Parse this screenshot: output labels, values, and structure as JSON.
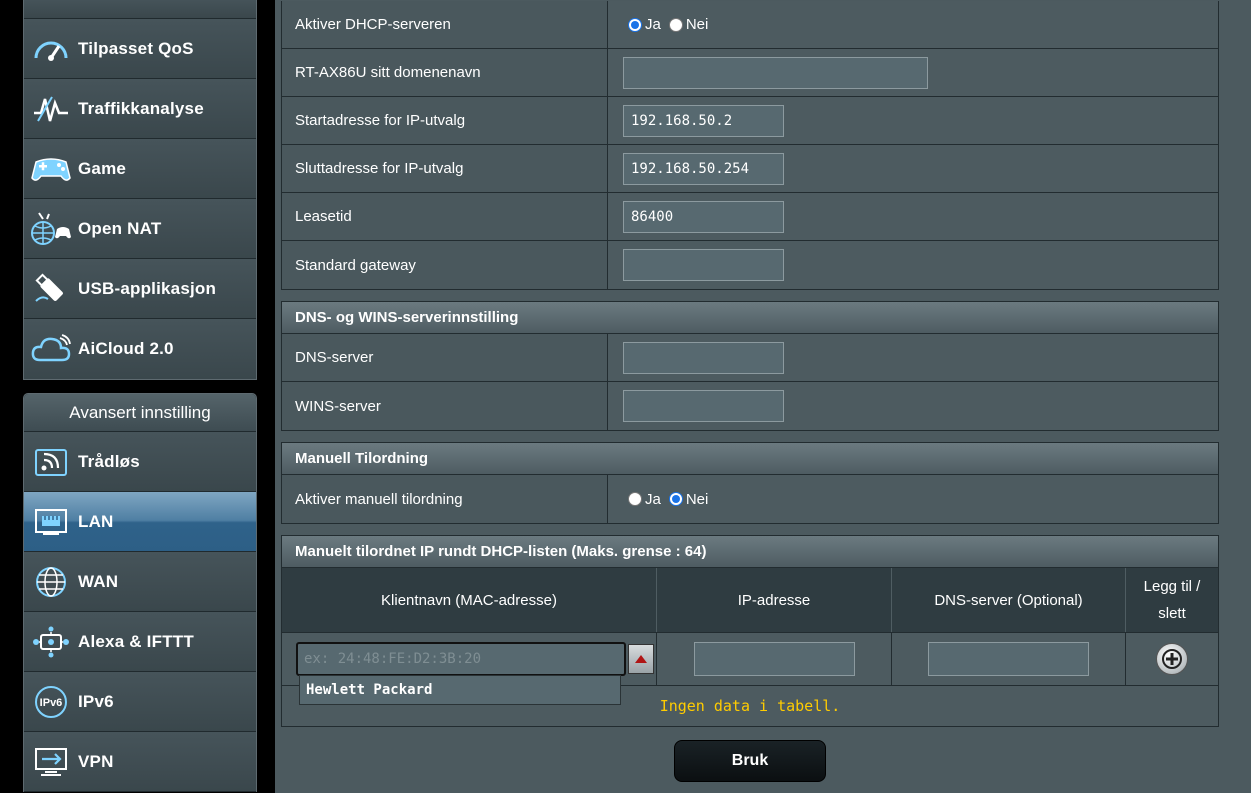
{
  "sidebar": {
    "general_items": [
      {
        "label": "Tilpasset QoS",
        "icon": "speedometer-icon"
      },
      {
        "label": "Traffikkanalyse",
        "icon": "traffic-analyzer-icon"
      },
      {
        "label": "Game",
        "icon": "gamepad-icon"
      },
      {
        "label": "Open NAT",
        "icon": "open-nat-icon"
      },
      {
        "label": "USB-applikasjon",
        "icon": "usb-icon"
      },
      {
        "label": "AiCloud 2.0",
        "icon": "cloud-icon"
      }
    ],
    "advanced_header": "Avansert innstilling",
    "advanced_items": [
      {
        "label": "Trådløs",
        "icon": "wireless-icon"
      },
      {
        "label": "LAN",
        "icon": "lan-icon",
        "active": true
      },
      {
        "label": "WAN",
        "icon": "globe-icon"
      },
      {
        "label": "Alexa & IFTTT",
        "icon": "alexa-icon"
      },
      {
        "label": "IPv6",
        "icon": "ipv6-icon"
      },
      {
        "label": "VPN",
        "icon": "vpn-icon"
      }
    ]
  },
  "dhcp": {
    "enable_label": "Aktiver DHCP-serveren",
    "enable_yes": "Ja",
    "enable_no": "Nei",
    "enable_value": "Ja",
    "domain_label": "RT-AX86U sitt domenenavn",
    "domain_value": "",
    "start_label": "Startadresse for IP-utvalg",
    "start_value": "192.168.50.2",
    "end_label": "Sluttadresse for IP-utvalg",
    "end_value": "192.168.50.254",
    "lease_label": "Leasetid",
    "lease_value": "86400",
    "gateway_label": "Standard gateway",
    "gateway_value": ""
  },
  "dns_wins": {
    "title": "DNS- og WINS-serverinnstilling",
    "dns_label": "DNS-server",
    "dns_value": "",
    "wins_label": "WINS-server",
    "wins_value": ""
  },
  "manual": {
    "title": "Manuell Tilordning",
    "enable_label": "Aktiver manuell tilordning",
    "yes": "Ja",
    "no": "Nei",
    "value": "Nei"
  },
  "manual_list": {
    "title": "Manuelt tilordnet IP rundt DHCP-listen (Maks. grense : 64)",
    "col_client": "Klientnavn (MAC-adresse)",
    "col_ip": "IP-adresse",
    "col_dns": "DNS-server (Optional)",
    "col_add_line1": "Legg til /",
    "col_add_line2": "slett",
    "mac_placeholder": "ex: 24:48:FE:D2:3B:20",
    "dropdown_option": "Hewlett Packard",
    "empty_text": "Ingen data i tabell."
  },
  "apply_label": "Bruk",
  "colors": {
    "accent_blue": "#1a73e8",
    "empty_text_yellow": "#ffcc00",
    "active_tab": "#2f628a"
  }
}
